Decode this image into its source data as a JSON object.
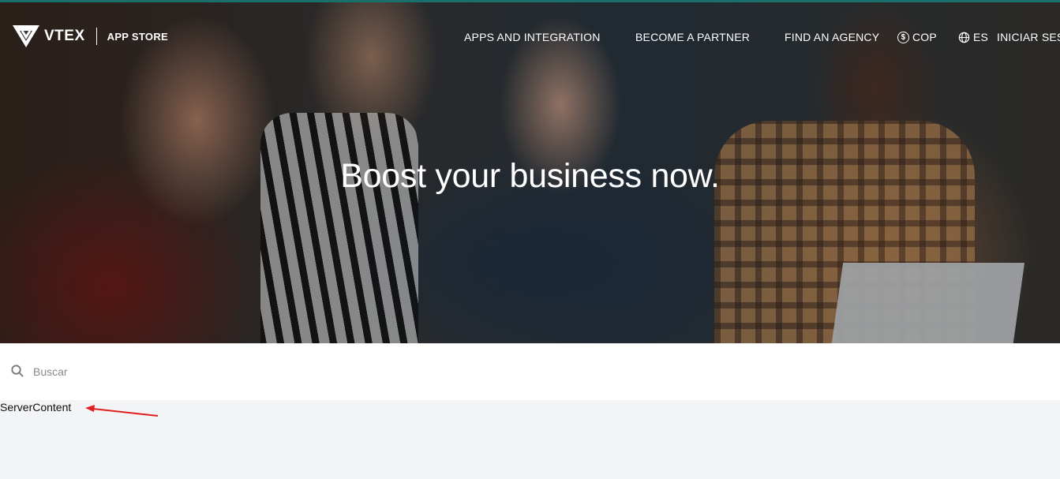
{
  "header": {
    "logo_text": "VTEX",
    "logo_subtitle": "APP STORE",
    "nav": {
      "apps": "APPS AND INTEGRATION",
      "partner": "BECOME A PARTNER",
      "agency": "FIND AN AGENCY",
      "currency": "COP",
      "language": "ES",
      "login": "INICIAR SESIÓN"
    },
    "icons": {
      "currency": "dollar-circle-icon",
      "language": "globe-icon",
      "logo": "vtex-logo-icon"
    }
  },
  "hero": {
    "title": "Boost your business now."
  },
  "search": {
    "placeholder": "Buscar",
    "value": "",
    "icon": "search-icon"
  },
  "content": {
    "server_content": "ServerContent"
  },
  "colors": {
    "top_accent": "#1b6f6a",
    "annotation_arrow": "#e02020",
    "page_background": "#f3f4f6"
  }
}
